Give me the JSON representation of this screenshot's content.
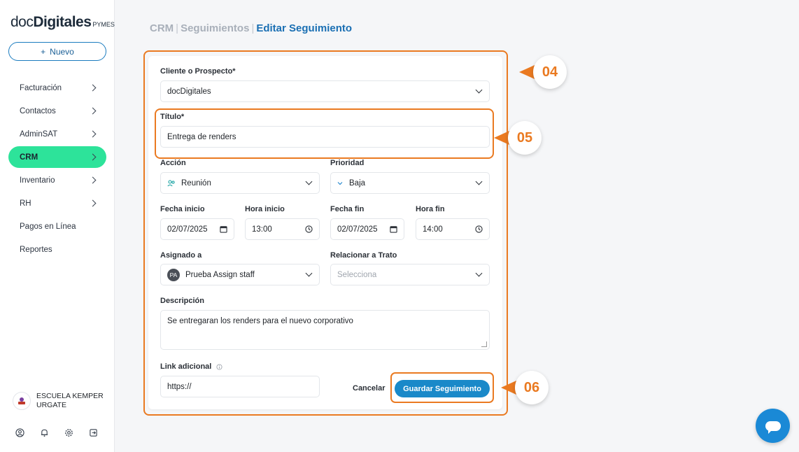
{
  "brand": {
    "doc": "doc",
    "digitales": "Digitales",
    "pymes": "PYMES"
  },
  "sidebar": {
    "new_button": "Nuevo",
    "items": [
      {
        "label": "Facturación",
        "has_arrow": true,
        "active": false
      },
      {
        "label": "Contactos",
        "has_arrow": true,
        "active": false
      },
      {
        "label": "AdminSAT",
        "has_arrow": true,
        "active": false
      },
      {
        "label": "CRM",
        "has_arrow": true,
        "active": true
      },
      {
        "label": "Inventario",
        "has_arrow": true,
        "active": false
      },
      {
        "label": "RH",
        "has_arrow": true,
        "active": false
      },
      {
        "label": "Pagos en Línea",
        "has_arrow": false,
        "active": false
      },
      {
        "label": "Reportes",
        "has_arrow": false,
        "active": false
      }
    ],
    "org_name": "ESCUELA KEMPER URGATE"
  },
  "breadcrumb": {
    "part1": "CRM",
    "sep": "|",
    "part2": "Seguimientos",
    "current": "Editar Seguimiento"
  },
  "form": {
    "cliente": {
      "label": "Cliente o Prospecto*",
      "value": "docDigitales"
    },
    "titulo": {
      "label": "Título*",
      "value": "Entrega de renders"
    },
    "accion": {
      "label": "Acción",
      "value": "Reunión"
    },
    "prioridad": {
      "label": "Prioridad",
      "value": "Baja"
    },
    "fecha_inicio": {
      "label": "Fecha inicio",
      "value": "02/07/2025"
    },
    "hora_inicio": {
      "label": "Hora inicio",
      "value": "13:00"
    },
    "fecha_fin": {
      "label": "Fecha fin",
      "value": "02/07/2025"
    },
    "hora_fin": {
      "label": "Hora fin",
      "value": "14:00"
    },
    "asignado": {
      "label": "Asignado a",
      "initials": "PA",
      "value": "Prueba Assign staff"
    },
    "trato": {
      "label": "Relacionar a Trato",
      "placeholder": "Selecciona"
    },
    "descripcion": {
      "label": "Descripción",
      "value": "Se entregaran los renders para el nuevo corporativo"
    },
    "link": {
      "label": "Link adicional",
      "value": "https://"
    },
    "cancel_label": "Cancelar",
    "save_label": "Guardar Seguimiento"
  },
  "steps": {
    "s04": "04",
    "s05": "05",
    "s06": "06"
  },
  "colors": {
    "accent": "#1a89c9",
    "active_nav": "#2de39a",
    "highlight": "#ea7a21"
  }
}
